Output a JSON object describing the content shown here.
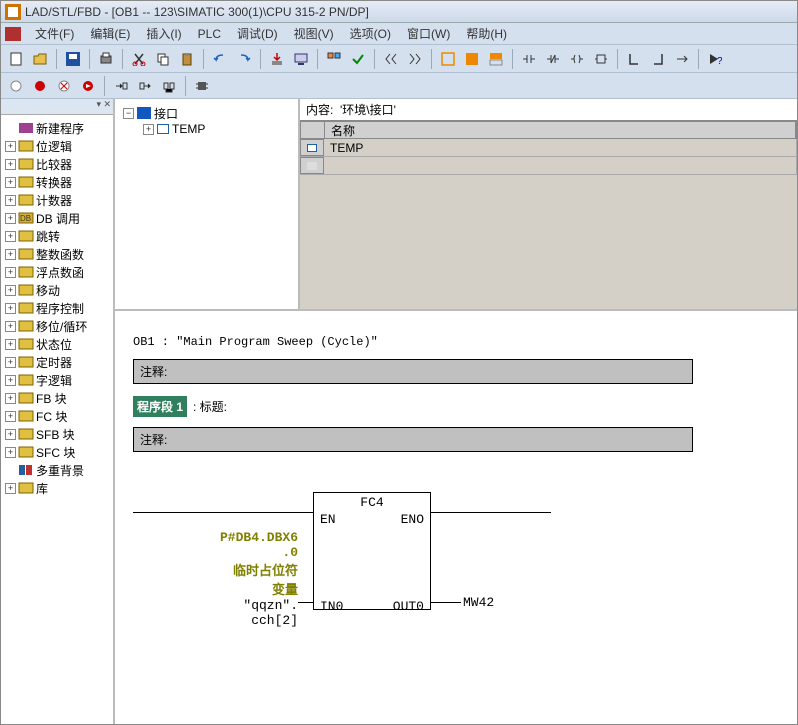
{
  "title": "LAD/STL/FBD  - [OB1 -- 123\\SIMATIC 300(1)\\CPU 315-2 PN/DP]",
  "menu": [
    "文件(F)",
    "编辑(E)",
    "插入(I)",
    "PLC",
    "调试(D)",
    "视图(V)",
    "选项(O)",
    "窗口(W)",
    "帮助(H)"
  ],
  "sidebar": {
    "items": [
      {
        "exp": "",
        "icon": "#a04090",
        "label": "新建程序"
      },
      {
        "exp": "+",
        "icon": "#e0c040",
        "label": "位逻辑"
      },
      {
        "exp": "+",
        "icon": "#e0c040",
        "label": "比较器"
      },
      {
        "exp": "+",
        "icon": "#e0c040",
        "label": "转换器"
      },
      {
        "exp": "+",
        "icon": "#e0c040",
        "label": "计数器"
      },
      {
        "exp": "+",
        "icon": "#d8b030",
        "label": "DB 调用"
      },
      {
        "exp": "+",
        "icon": "#e0c040",
        "label": "跳转"
      },
      {
        "exp": "+",
        "icon": "#e0c040",
        "label": "整数函数"
      },
      {
        "exp": "+",
        "icon": "#e0c040",
        "label": "浮点数函"
      },
      {
        "exp": "+",
        "icon": "#e0c040",
        "label": "移动"
      },
      {
        "exp": "+",
        "icon": "#e0c040",
        "label": "程序控制"
      },
      {
        "exp": "+",
        "icon": "#e0c040",
        "label": "移位/循环"
      },
      {
        "exp": "+",
        "icon": "#e0c040",
        "label": "状态位"
      },
      {
        "exp": "+",
        "icon": "#e0c040",
        "label": "定时器"
      },
      {
        "exp": "+",
        "icon": "#e0c040",
        "label": "字逻辑"
      },
      {
        "exp": "+",
        "icon": "#e0c040",
        "label": "FB 块"
      },
      {
        "exp": "+",
        "icon": "#e0c040",
        "label": "FC 块"
      },
      {
        "exp": "+",
        "icon": "#e0c040",
        "label": "SFB 块"
      },
      {
        "exp": "+",
        "icon": "#e0c040",
        "label": "SFC 块"
      },
      {
        "exp": "",
        "icon": "#2060a0",
        "label": "多重背景"
      },
      {
        "exp": "+",
        "icon": "#e0c040",
        "label": "库"
      }
    ]
  },
  "iface": {
    "root": "接口",
    "child": "TEMP"
  },
  "grid": {
    "content_label": "内容:",
    "content_value": "'环境\\接口'",
    "header": "名称",
    "rows": [
      "TEMP",
      ""
    ]
  },
  "editor": {
    "ob_line": "OB1 : \"Main Program Sweep (Cycle)\"",
    "comment_label": "注释:",
    "net_tag": "程序段 1",
    "net_title_label": ": 标题:",
    "block_name": "FC4",
    "en": "EN",
    "eno": "ENO",
    "in_pin": "IN0",
    "out_pin": "OUT0",
    "in_val1": "P#DB4.DBX6",
    "in_val2": ".0",
    "in_val3": "临时占位符",
    "in_val4": "变量",
    "in_val5": "\"qqzn\".",
    "in_val6": "cch[2]",
    "out_val": "MW42"
  }
}
